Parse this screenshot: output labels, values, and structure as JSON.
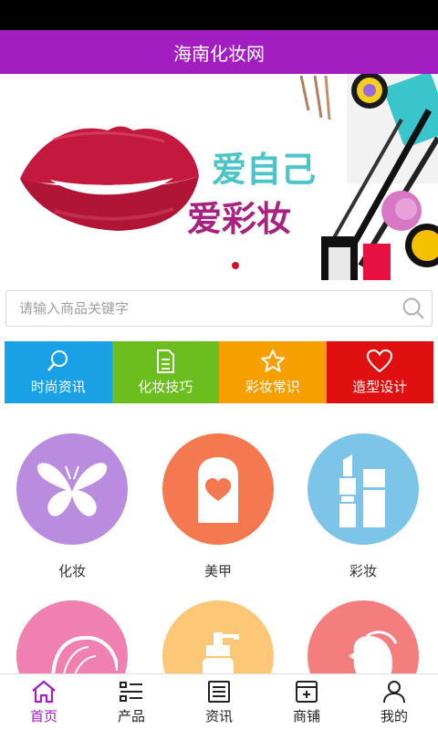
{
  "app": {
    "title": "海南化妆网"
  },
  "banner": {
    "line1": "爱自己",
    "line2": "爱彩妆",
    "dots_active": 1,
    "dots_total": 1
  },
  "search": {
    "placeholder": "请输入商品关键字",
    "icon": "search-icon"
  },
  "quick_nav": [
    {
      "label": "时尚资讯",
      "icon": "search-icon",
      "color": "#1aa0e4"
    },
    {
      "label": "化妆技巧",
      "icon": "document-icon",
      "color": "#6cbe1e"
    },
    {
      "label": "彩妆常识",
      "icon": "star-icon",
      "color": "#f5a000"
    },
    {
      "label": "造型设计",
      "icon": "heart-icon",
      "color": "#e01010"
    }
  ],
  "categories": [
    {
      "label": "化妆",
      "icon": "butterfly-icon",
      "color": "#b98ce0"
    },
    {
      "label": "美甲",
      "icon": "nail-icon",
      "color": "#f47850"
    },
    {
      "label": "彩妆",
      "icon": "lipstick-icon",
      "color": "#7cc4e8"
    },
    {
      "label": "",
      "icon": "hair-icon",
      "color": "#f080b0"
    },
    {
      "label": "",
      "icon": "pump-bottle-icon",
      "color": "#fcc878"
    },
    {
      "label": "",
      "icon": "face-profile-icon",
      "color": "#f47e7e"
    }
  ],
  "bottom_nav": [
    {
      "label": "首页",
      "icon": "home-icon",
      "active": true
    },
    {
      "label": "产品",
      "icon": "list-icon",
      "active": false
    },
    {
      "label": "资讯",
      "icon": "news-icon",
      "active": false
    },
    {
      "label": "商铺",
      "icon": "shop-icon",
      "active": false
    },
    {
      "label": "我的",
      "icon": "user-icon",
      "active": false
    }
  ],
  "colors": {
    "brand": "#a31ec1",
    "status_bar": "#000000"
  }
}
